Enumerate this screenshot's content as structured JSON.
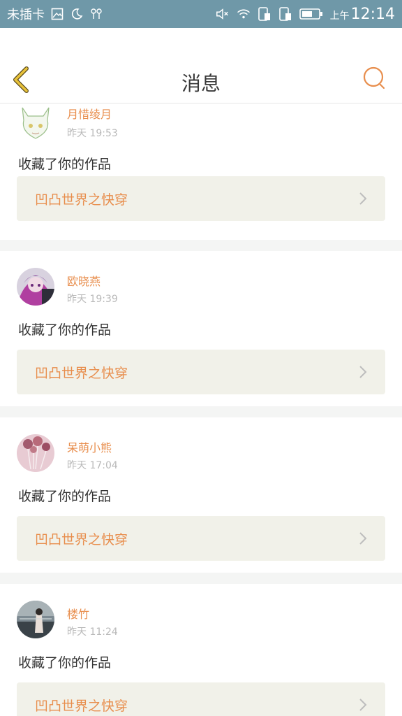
{
  "status_bar": {
    "carrier": "未插卡",
    "ampm": "上午",
    "time": "12:14"
  },
  "header": {
    "title": "消息"
  },
  "messages": [
    {
      "name": "月惜绫月",
      "time": "昨天 19:53",
      "action": "收藏了你的作品",
      "work": "凹凸世界之快穿"
    },
    {
      "name": "欧晓燕",
      "time": "昨天 19:39",
      "action": "收藏了你的作品",
      "work": "凹凸世界之快穿"
    },
    {
      "name": "呆萌小熊",
      "time": "昨天 17:04",
      "action": "收藏了你的作品",
      "work": "凹凸世界之快穿"
    },
    {
      "name": "楼竹",
      "time": "昨天 11:24",
      "action": "收藏了你的作品",
      "work": "凹凸世界之快穿"
    }
  ],
  "colors": {
    "status_bar": "#6f98a8",
    "accent": "#e88e4d",
    "work_bg": "#f1f1e9",
    "back_icon": "#e8c23a"
  },
  "icons": {
    "back": "chevron-left-icon",
    "search": "search-icon",
    "work_arrow": "chevron-right-icon"
  }
}
